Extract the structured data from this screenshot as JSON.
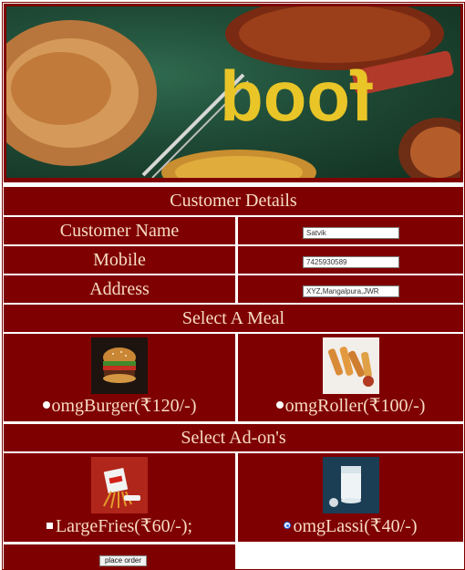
{
  "hero": {
    "word": "food"
  },
  "sections": {
    "customer_details": "Customer Details",
    "select_meal": "Select A Meal",
    "select_addons": "Select Ad-on's"
  },
  "fields": {
    "name_label": "Customer Name",
    "name_value": "Satvik",
    "mobile_label": "Mobile",
    "mobile_value": "7425930589",
    "address_label": "Address",
    "address_value": "XYZ,Mangalpura,JWR"
  },
  "meals": [
    {
      "label": "omgBurger(₹120/-)",
      "selected": false
    },
    {
      "label": "omgRoller(₹100/-)",
      "selected": false
    }
  ],
  "addons": [
    {
      "label": "LargeFries(₹60/-);",
      "type": "checkbox",
      "checked": false
    },
    {
      "label": "omgLassi(₹40/-)",
      "type": "radio",
      "checked": true
    }
  ],
  "actions": {
    "place_order": "place order"
  },
  "colors": {
    "maroon": "#7f0000",
    "text": "#f6dcc4",
    "radio_accent": "#2a6fe8"
  }
}
